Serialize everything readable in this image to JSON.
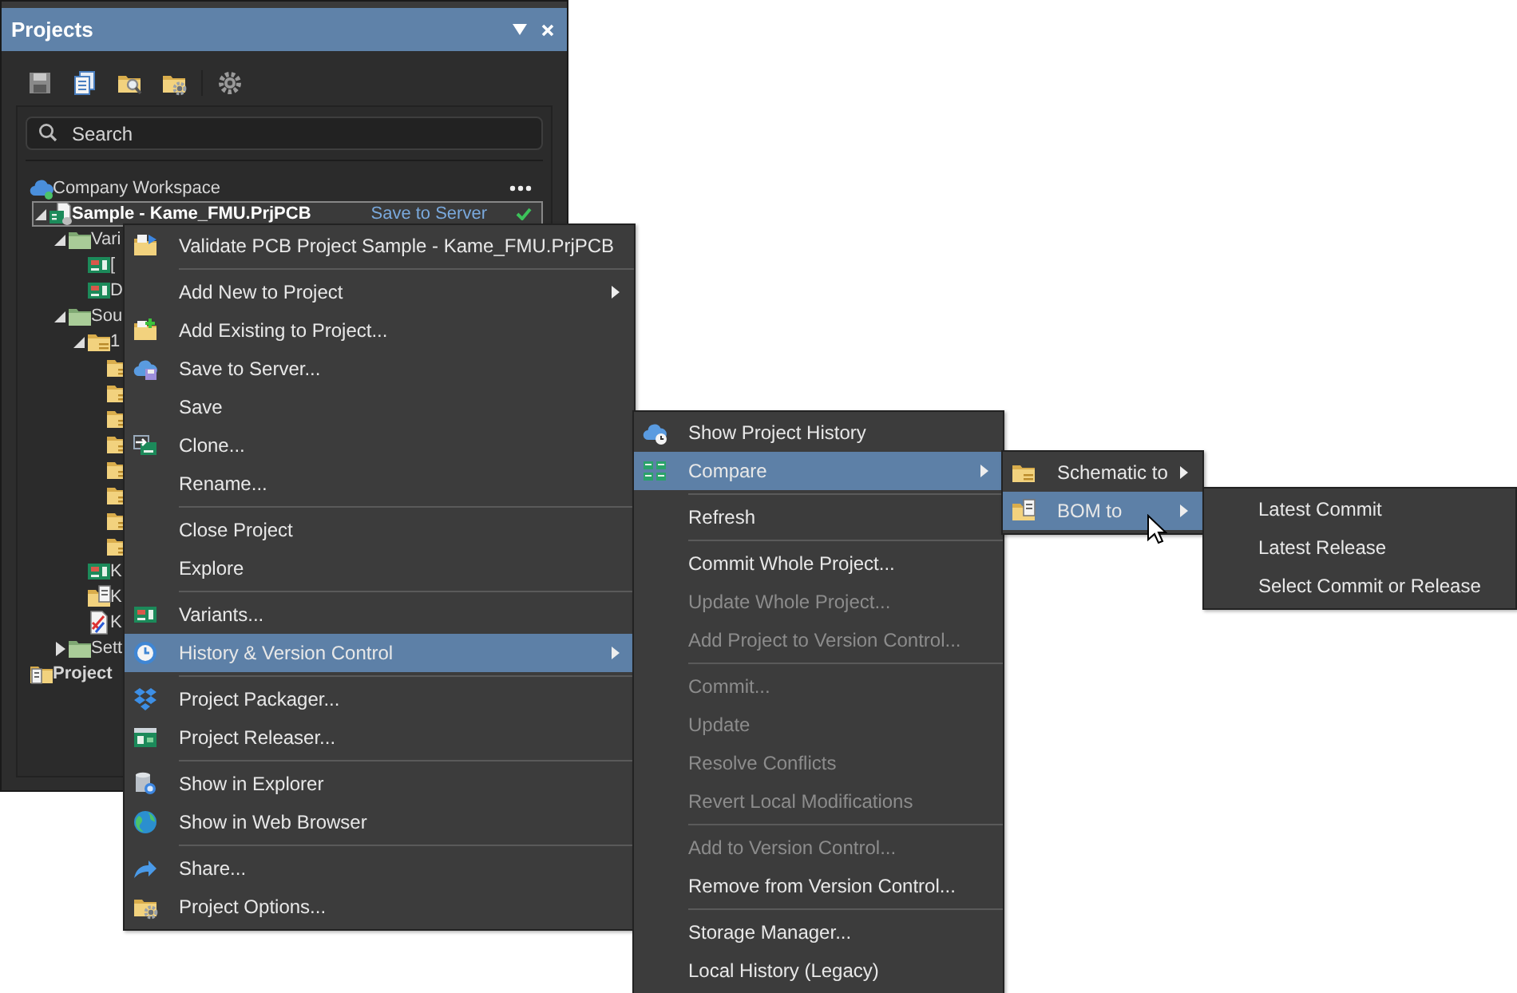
{
  "panel": {
    "title": "Projects",
    "search": {
      "placeholder": "Search"
    },
    "tree": [
      {
        "label": "Company Workspace",
        "kind": "workspace",
        "selected": false,
        "children": [
          {
            "label": "Sample - Kame_FMU.PrjPCB",
            "kind": "project",
            "status": "Save to Server",
            "synced": true,
            "expanded": true,
            "selected": true,
            "children": [
              {
                "label": "Vari",
                "kind": "folder",
                "expanded": true,
                "selected": false,
                "children": [
                  {
                    "label": "[",
                    "kind": "pcb",
                    "selected": false
                  },
                  {
                    "label": "D",
                    "kind": "pcb",
                    "selected": false
                  }
                ]
              },
              {
                "label": "Sou",
                "kind": "folder",
                "expanded": true,
                "selected": false,
                "children": [
                  {
                    "label": "1",
                    "kind": "sheet",
                    "expanded": true,
                    "selected": false,
                    "children": [
                      {
                        "kind": "sheet",
                        "selected": false
                      },
                      {
                        "kind": "sheet",
                        "selected": false
                      },
                      {
                        "kind": "sheet",
                        "selected": false
                      },
                      {
                        "kind": "sheet",
                        "selected": false
                      },
                      {
                        "kind": "sheet",
                        "selected": false
                      },
                      {
                        "kind": "sheet",
                        "selected": false
                      },
                      {
                        "kind": "sheet",
                        "selected": false
                      },
                      {
                        "kind": "sheet",
                        "selected": false
                      }
                    ]
                  },
                  {
                    "label": "K",
                    "kind": "pcb",
                    "selected": false
                  },
                  {
                    "label": "K",
                    "kind": "bom",
                    "selected": false
                  },
                  {
                    "label": "K",
                    "kind": "doc",
                    "selected": false
                  }
                ]
              },
              {
                "label": "Sett",
                "kind": "folder",
                "expanded": false,
                "selected": false
              }
            ]
          }
        ]
      },
      {
        "label": "Project",
        "kind": "group",
        "selected": false
      }
    ]
  },
  "menus": [
    {
      "items": [
        {
          "kind": "item",
          "label": "Validate PCB Project Sample - Kame_FMU.PrjPCB",
          "submenu": false,
          "selected": false,
          "disabled": false
        },
        {
          "kind": "separator"
        },
        {
          "kind": "item",
          "label": "Add New to Project",
          "submenu": true,
          "selected": false,
          "disabled": false
        },
        {
          "kind": "item",
          "label": "Add Existing to Project...",
          "submenu": false,
          "selected": false,
          "disabled": false
        },
        {
          "kind": "item",
          "label": "Save to Server...",
          "submenu": false,
          "selected": false,
          "disabled": false
        },
        {
          "kind": "item",
          "label": "Save",
          "submenu": false,
          "selected": false,
          "disabled": false
        },
        {
          "kind": "item",
          "label": "Clone...",
          "submenu": false,
          "selected": false,
          "disabled": false
        },
        {
          "kind": "item",
          "label": "Rename...",
          "submenu": false,
          "selected": false,
          "disabled": false
        },
        {
          "kind": "separator"
        },
        {
          "kind": "item",
          "label": "Close Project",
          "submenu": false,
          "selected": false,
          "disabled": false
        },
        {
          "kind": "item",
          "label": "Explore",
          "submenu": false,
          "selected": false,
          "disabled": false
        },
        {
          "kind": "separator"
        },
        {
          "kind": "item",
          "label": "Variants...",
          "submenu": false,
          "selected": false,
          "disabled": false
        },
        {
          "kind": "item",
          "label": "History & Version Control",
          "submenu": true,
          "selected": true,
          "disabled": false
        },
        {
          "kind": "separator"
        },
        {
          "kind": "item",
          "label": "Project Packager...",
          "submenu": false,
          "selected": false,
          "disabled": false
        },
        {
          "kind": "item",
          "label": "Project Releaser...",
          "submenu": false,
          "selected": false,
          "disabled": false
        },
        {
          "kind": "separator"
        },
        {
          "kind": "item",
          "label": "Show in Explorer",
          "submenu": false,
          "selected": false,
          "disabled": false
        },
        {
          "kind": "item",
          "label": "Show in Web Browser",
          "submenu": false,
          "selected": false,
          "disabled": false
        },
        {
          "kind": "separator"
        },
        {
          "kind": "item",
          "label": "Share...",
          "submenu": false,
          "selected": false,
          "disabled": false
        },
        {
          "kind": "item",
          "label": "Project Options...",
          "submenu": false,
          "selected": false,
          "disabled": false
        }
      ]
    },
    {
      "items": [
        {
          "kind": "item",
          "label": "Show Project History",
          "submenu": false,
          "selected": false,
          "disabled": false
        },
        {
          "kind": "item",
          "label": "Compare",
          "submenu": true,
          "selected": true,
          "disabled": false
        },
        {
          "kind": "separator"
        },
        {
          "kind": "item",
          "label": "Refresh",
          "submenu": false,
          "selected": false,
          "disabled": false
        },
        {
          "kind": "separator"
        },
        {
          "kind": "item",
          "label": "Commit Whole Project...",
          "submenu": false,
          "selected": false,
          "disabled": false
        },
        {
          "kind": "item",
          "label": "Update Whole Project...",
          "submenu": false,
          "selected": false,
          "disabled": true
        },
        {
          "kind": "item",
          "label": "Add Project to Version Control...",
          "submenu": false,
          "selected": false,
          "disabled": true
        },
        {
          "kind": "separator"
        },
        {
          "kind": "item",
          "label": "Commit...",
          "submenu": false,
          "selected": false,
          "disabled": true
        },
        {
          "kind": "item",
          "label": "Update",
          "submenu": false,
          "selected": false,
          "disabled": true
        },
        {
          "kind": "item",
          "label": "Resolve Conflicts",
          "submenu": false,
          "selected": false,
          "disabled": true
        },
        {
          "kind": "item",
          "label": "Revert Local Modifications",
          "submenu": false,
          "selected": false,
          "disabled": true
        },
        {
          "kind": "separator"
        },
        {
          "kind": "item",
          "label": "Add to Version Control...",
          "submenu": false,
          "selected": false,
          "disabled": true
        },
        {
          "kind": "item",
          "label": "Remove from Version Control...",
          "submenu": false,
          "selected": false,
          "disabled": false
        },
        {
          "kind": "separator"
        },
        {
          "kind": "item",
          "label": "Storage Manager...",
          "submenu": false,
          "selected": false,
          "disabled": false
        },
        {
          "kind": "item",
          "label": "Local History (Legacy)",
          "submenu": false,
          "selected": false,
          "disabled": false
        }
      ]
    },
    {
      "items": [
        {
          "kind": "item",
          "label": "Schematic to",
          "submenu": true,
          "selected": false,
          "disabled": false
        },
        {
          "kind": "item",
          "label": "BOM to",
          "submenu": true,
          "selected": true,
          "disabled": false
        }
      ]
    },
    {
      "items": [
        {
          "kind": "item",
          "label": "Latest Commit",
          "submenu": false,
          "selected": false,
          "disabled": false
        },
        {
          "kind": "item",
          "label": "Latest Release",
          "submenu": false,
          "selected": false,
          "disabled": false
        },
        {
          "kind": "item",
          "label": "Select Commit or Release",
          "submenu": false,
          "selected": false,
          "disabled": false
        }
      ]
    }
  ]
}
